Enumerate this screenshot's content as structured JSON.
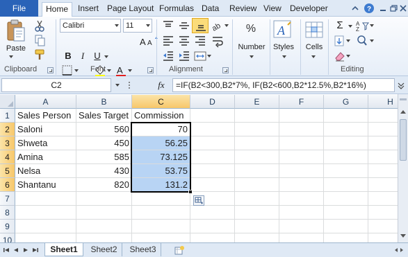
{
  "ribbon": {
    "tabs": [
      "File",
      "Home",
      "Insert",
      "Page Layout",
      "Formulas",
      "Data",
      "Review",
      "View",
      "Developer"
    ],
    "clipboard": {
      "paste": "Paste",
      "label": "Clipboard"
    },
    "font": {
      "name": "Calibri",
      "size": "11",
      "label": "Font",
      "bold": "B",
      "italic": "I",
      "underline": "U",
      "font_color_glyph": "A"
    },
    "alignment": {
      "label": "Alignment"
    },
    "number": {
      "glyph": "%",
      "label": "Number"
    },
    "styles": {
      "glyph": "A",
      "label": "Styles"
    },
    "cells": {
      "label": "Cells"
    },
    "editing": {
      "label": "Editing",
      "sum_glyph": "Σ"
    }
  },
  "formula_bar": {
    "name_box": "C2",
    "fx": "fx",
    "formula": "=IF(B2<300,B2*7%, IF(B2<600,B2*12.5%,B2*16%)"
  },
  "grid": {
    "columns": [
      "A",
      "B",
      "C",
      "D",
      "E",
      "F",
      "G",
      "H"
    ],
    "selected_column": "C",
    "rows": [
      "1",
      "2",
      "3",
      "4",
      "5",
      "6",
      "7",
      "8",
      "9",
      "10"
    ],
    "selected_rows": [
      "2",
      "3",
      "4",
      "5",
      "6"
    ],
    "headers": [
      "Sales Person",
      "Sales Target",
      "Commission"
    ],
    "data": [
      {
        "name": "Saloni",
        "target": "560",
        "commission": "70"
      },
      {
        "name": "Shweta",
        "target": "450",
        "commission": "56.25"
      },
      {
        "name": "Amina",
        "target": "585",
        "commission": "73.125"
      },
      {
        "name": "Nelsa",
        "target": "430",
        "commission": "53.75"
      },
      {
        "name": "Shantanu",
        "target": "820",
        "commission": "131.2"
      }
    ]
  },
  "sheets": {
    "tabs": [
      "Sheet1",
      "Sheet2",
      "Sheet3"
    ],
    "active": "Sheet1"
  },
  "colors": {
    "selection": "#b8d4f4",
    "file_tab": "#2a63b8",
    "header_selected": "#f7c76a"
  }
}
